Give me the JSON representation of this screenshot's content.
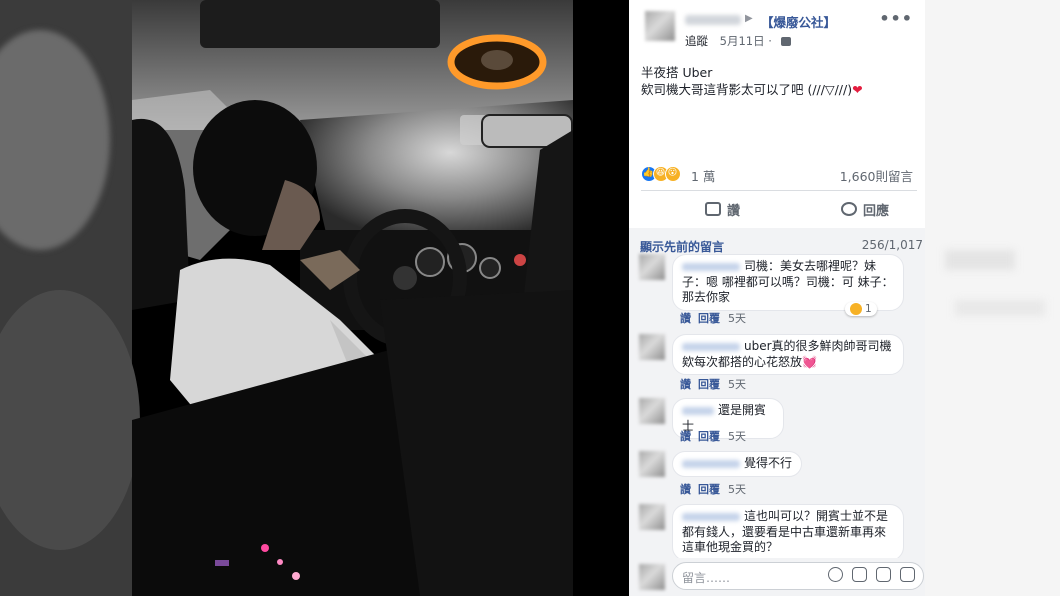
{
  "post": {
    "group_name": "【爆廢公社】",
    "follow_label": "追蹤",
    "date": "5月11日",
    "line1": "半夜搭 Uber",
    "line2": "欸司機大哥這背影太可以了吧 (///▽///)",
    "heart": "❤"
  },
  "stats": {
    "reactions_count": "1 萬",
    "comments_count": "1,660則留言"
  },
  "actions": {
    "like_label": "讚",
    "comment_label": "回應"
  },
  "comments_section": {
    "show_previous": "顯示先前的留言",
    "shown_of_total": "256/1,017",
    "like_label": "讚",
    "reply_label": "回覆",
    "items": [
      {
        "text": "司機：美女去哪裡呢？妹子：嗯 哪裡都可以嗎？司機：可 妹子：那去你家",
        "time": "5天",
        "reaction_count": "1"
      },
      {
        "text": "uber真的很多鮮肉帥哥司機欸每次都搭的心花怒放💓",
        "time": "5天"
      },
      {
        "text": "還是開賓士",
        "time": "5天"
      },
      {
        "text": "覺得不行",
        "time": "5天"
      },
      {
        "text": "這也叫可以？開賓士並不是都有錢人，還要看是中古車還新車再來這車他現金買的？",
        "time": ""
      }
    ]
  },
  "input": {
    "placeholder": "留言……"
  },
  "icons": [
    "more-icon",
    "globe-icon",
    "like-reaction-icon",
    "haha-reaction-icon",
    "wow-reaction-icon",
    "thumb-icon",
    "comment-icon",
    "emoji-icon",
    "camera-icon",
    "gif-icon",
    "sticker-icon"
  ],
  "colors": {
    "link": "#385898",
    "like_blue": "#1877f2",
    "heart_red": "#e41e3f",
    "comment_bg": "#f2f3f5"
  }
}
